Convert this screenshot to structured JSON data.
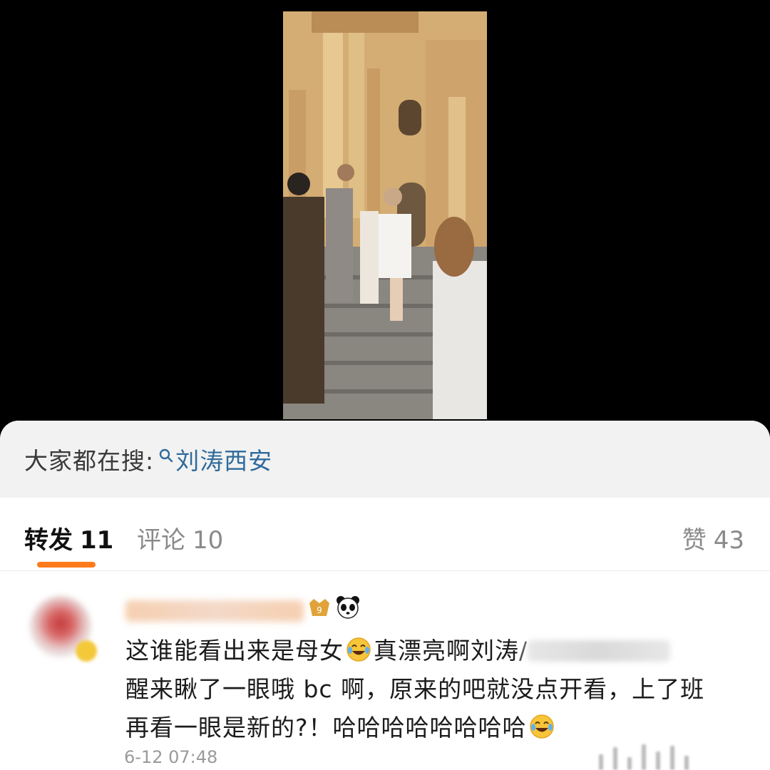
{
  "video": {
    "description_icon": "video-thumbnail"
  },
  "trending": {
    "label": "大家都在搜:",
    "search_icon": "search-icon",
    "term": "刘涛西安"
  },
  "tabs": {
    "repost": {
      "label": "转发",
      "count": "11"
    },
    "comment": {
      "label": "评论",
      "count": "10"
    },
    "like": {
      "label": "赞",
      "count": "43"
    },
    "accent_color": "#ff7a1a"
  },
  "comment": {
    "line1_a": "这谁能看出来是母女",
    "line1_b": "真漂亮啊刘涛",
    "slash": "/",
    "line2": "醒来瞅了一眼哦 bc 啊，原来的吧就没点开看，上了班",
    "line3": "再看一眼是新的?！哈哈哈哈哈哈哈哈",
    "timestamp": "6-12 07:48",
    "link_color": "#2f6a9c"
  }
}
